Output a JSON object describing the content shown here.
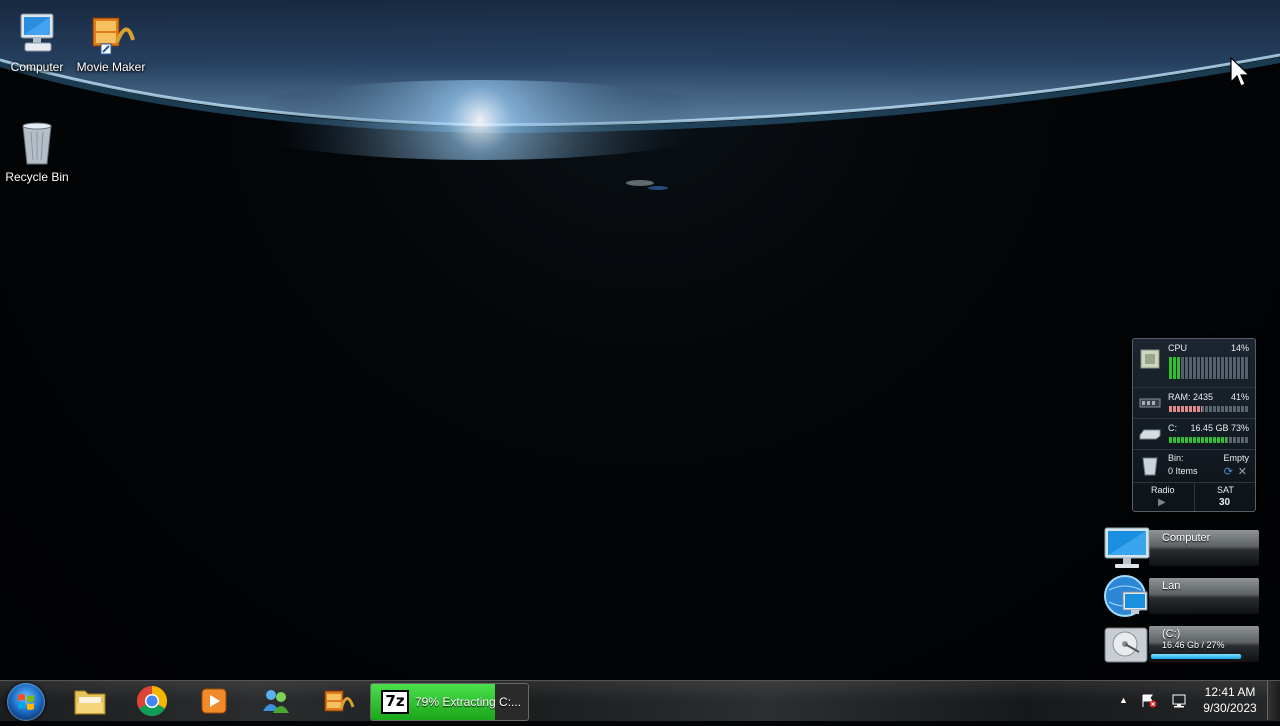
{
  "desktop": {
    "icons": [
      {
        "label": "Computer",
        "icon": "computer-icon"
      },
      {
        "label": "Movie Maker",
        "icon": "movie-maker-icon"
      },
      {
        "label": "Recycle Bin",
        "icon": "recycle-bin-icon"
      }
    ]
  },
  "system_gadget": {
    "cpu": {
      "label": "CPU",
      "value": "14%",
      "level": 0.14
    },
    "ram": {
      "label": "RAM: 2435",
      "value": "41%",
      "level": 0.41
    },
    "disk": {
      "label": "C:",
      "value": "16.45 GB 73%",
      "level": 0.73
    },
    "bin": {
      "label": "Bin:",
      "status": "Empty",
      "items": "0 Items"
    },
    "radio": {
      "label": "Radio"
    },
    "date": {
      "day": "SAT",
      "num": "30"
    }
  },
  "drive_gadgets": [
    {
      "name": "Computer",
      "sub": "",
      "icon": "monitor-icon"
    },
    {
      "name": "Lan",
      "sub": "",
      "icon": "network-globe-icon"
    },
    {
      "name": "(C:)",
      "sub": "16.46 Gb / 27%",
      "icon": "hard-drive-icon",
      "usage": 0.98
    }
  ],
  "taskbar": {
    "pinned": [
      {
        "name": "windows-explorer",
        "icon": "folder-icon"
      },
      {
        "name": "chrome",
        "icon": "chrome-icon"
      },
      {
        "name": "media-player",
        "icon": "media-player-icon"
      },
      {
        "name": "messenger",
        "icon": "messenger-icon"
      },
      {
        "name": "movie-maker",
        "icon": "movie-maker-icon"
      }
    ],
    "active_task": {
      "logo": "7z",
      "label": "79% Extracting C:...",
      "progress": 0.79
    },
    "clock": {
      "time": "12:41 AM",
      "date": "9/30/2023"
    },
    "colors": {
      "progress": "#2bc42b",
      "start": "#1e6fc8"
    }
  }
}
